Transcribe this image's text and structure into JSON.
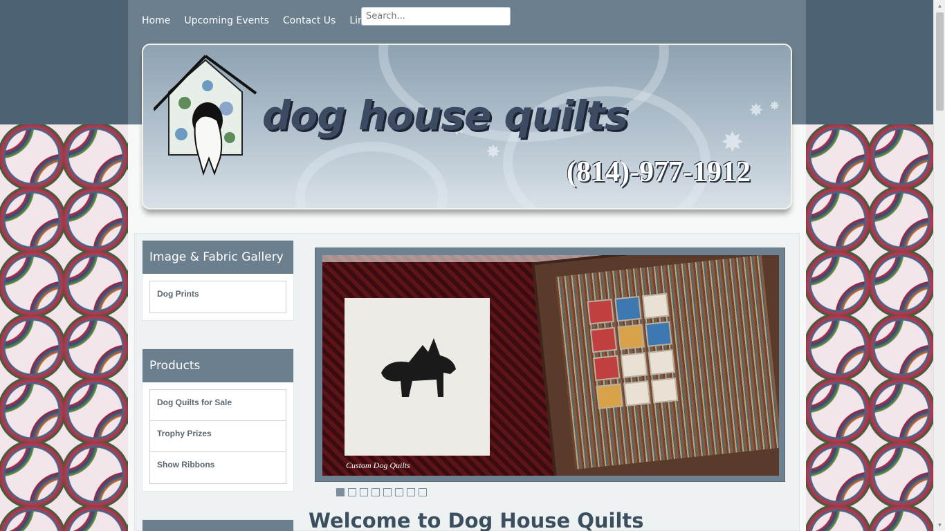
{
  "nav": {
    "items": [
      "Home",
      "Upcoming Events",
      "Contact Us",
      "Links"
    ],
    "search_placeholder": "Search..."
  },
  "banner": {
    "title": "dog house quilts",
    "phone": "(814)-977-1912"
  },
  "sidebar": {
    "modules": [
      {
        "title": "Image & Fabric Gallery",
        "items": [
          "Dog Prints"
        ]
      },
      {
        "title": "Products",
        "items": [
          "Dog Quilts for Sale",
          "Trophy Prizes",
          "Show Ribbons"
        ]
      },
      {
        "title": "",
        "items": []
      }
    ]
  },
  "slideshow": {
    "caption": "Custom Dog Quilts",
    "dot_count": 8,
    "active_index": 0
  },
  "main": {
    "heading": "Welcome to Dog House Quilts"
  },
  "colors": {
    "accent": "#6c7f8e",
    "background": "#4d6272",
    "title": "#3c4a62"
  }
}
